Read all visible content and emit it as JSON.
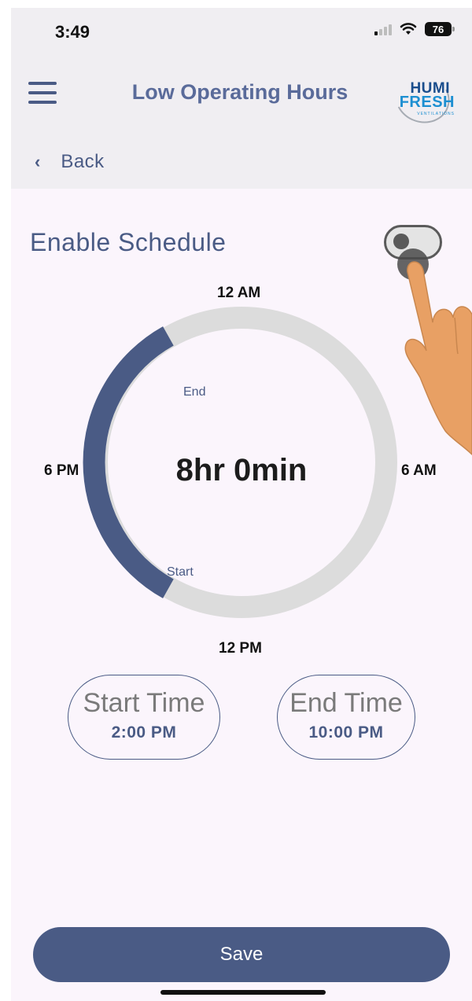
{
  "status_bar": {
    "time": "3:49",
    "battery": "76",
    "signal_icon": "signal-icon",
    "wifi_icon": "wifi-icon",
    "battery_icon": "battery-icon"
  },
  "header": {
    "title": "Low Operating Hours",
    "menu_icon": "hamburger-menu-icon",
    "logo": {
      "line1": "HUMI",
      "line2": "FRESH",
      "line3": "VENTILATIONS"
    }
  },
  "nav": {
    "back_label": "Back",
    "back_icon": "chevron-left-icon"
  },
  "schedule": {
    "enable_label": "Enable Schedule",
    "enabled": false,
    "dial": {
      "top_label": "12 AM",
      "right_label": "6 AM",
      "bottom_label": "12 PM",
      "left_label": "6 PM",
      "duration": "8hr 0min",
      "start_marker": "Start",
      "end_marker": "End",
      "active_color": "#4a5b85",
      "track_color": "#dcdcdc"
    },
    "start": {
      "label": "Start Time",
      "value": "2:00 PM"
    },
    "end": {
      "label": "End Time",
      "value": "10:00 PM"
    }
  },
  "save_label": "Save",
  "colors": {
    "primary": "#4a5b85",
    "background": "#fbf5fc",
    "header_bg": "#f0eef2"
  }
}
